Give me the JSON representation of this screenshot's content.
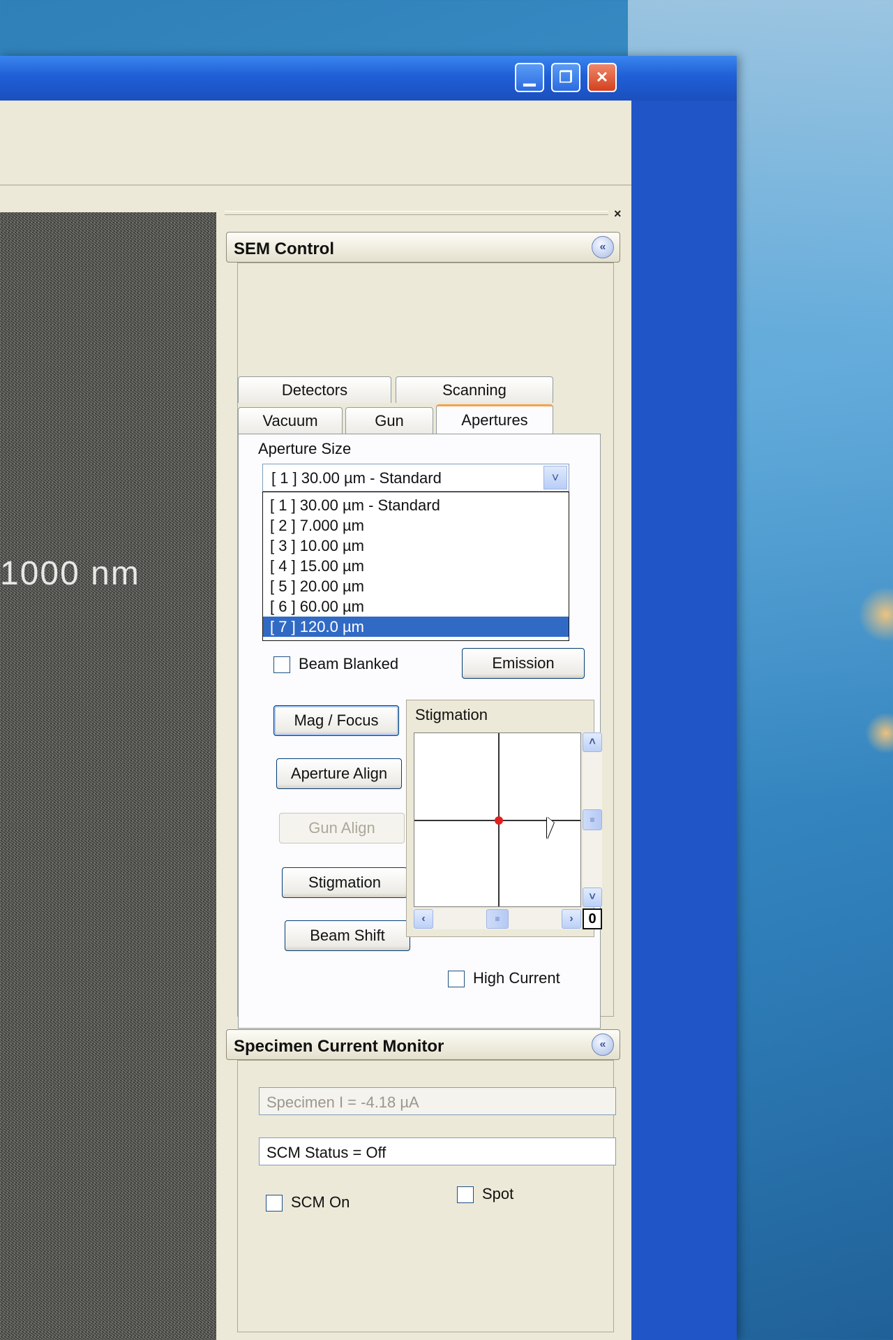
{
  "colors": {
    "titlebar": "#1f5fd6",
    "selection": "#316ac5",
    "tab_accent": "#f6a24a",
    "stigmation_marker": "#e02020"
  },
  "window": {
    "controls": {
      "minimize_icon": "minimize-icon",
      "restore_icon": "restore-icon",
      "close_icon": "close-icon"
    }
  },
  "image": {
    "scale_label": "1000 nm"
  },
  "panel": {
    "close_glyph": "×",
    "sem_control": {
      "title": "SEM Control",
      "collapse_glyph": "«",
      "tabs_row1": [
        "Detectors",
        "Scanning"
      ],
      "tabs_row2": [
        "Vacuum",
        "Gun",
        "Apertures"
      ],
      "active_tab": "Apertures",
      "aperture_size_label": "Aperture Size",
      "aperture_selected": "[ 1 ] 30.00 µm - Standard",
      "aperture_options": [
        "[ 1 ] 30.00 µm - Standard",
        "[ 2 ] 7.000 µm",
        "[ 3 ] 10.00 µm",
        "[ 4 ] 15.00 µm",
        "[ 5 ] 20.00 µm",
        "[ 6 ] 60.00 µm",
        "[ 7 ] 120.0 µm"
      ],
      "highlighted_option": "[ 7 ] 120.0 µm",
      "beam_blanked_label": "Beam Blanked",
      "emission_button": "Emission",
      "buttons": {
        "mag_focus": "Mag / Focus",
        "aperture_align": "Aperture Align",
        "gun_align": "Gun Align",
        "stigmation": "Stigmation",
        "beam_shift": "Beam Shift"
      },
      "stigmation_box": {
        "title": "Stigmation",
        "up_glyph": "˄",
        "down_glyph": "˅",
        "left_glyph": "‹",
        "right_glyph": "›",
        "thumb_glyph": "≡",
        "zero_label": "0"
      },
      "high_current_label": "High Current"
    },
    "specimen_monitor": {
      "title": "Specimen Current Monitor",
      "collapse_glyph": "«",
      "specimen_current": "Specimen I =  -4.18 µA",
      "scm_status": "SCM Status = Off",
      "scm_on_label": "SCM On",
      "spot_label": "Spot"
    }
  }
}
